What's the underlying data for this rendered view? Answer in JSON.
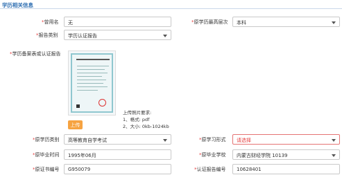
{
  "section": {
    "title": "学历相关信息"
  },
  "form": {
    "used_name": {
      "label": "曾用名",
      "value": "无"
    },
    "highest_level": {
      "label": "原学历最高层次",
      "value": "本科"
    },
    "report_type": {
      "label": "报告类别",
      "value": "学历认证报告"
    },
    "cert_upload": {
      "label": "学历备案表或认证报告",
      "upload_label": "上传"
    },
    "requirements": {
      "title": "上传照片要求:",
      "format": "1、格式: pdf",
      "size": "2、大小: 0kb-1024kb"
    },
    "edu_type": {
      "label": "原学历类别",
      "value": "高等教育自学考试"
    },
    "study_form": {
      "label": "原学习形式",
      "placeholder": "请选择"
    },
    "grad_time": {
      "label": "原毕业时间",
      "value": "1995年06月"
    },
    "grad_school": {
      "label": "原毕业学校",
      "value": "内蒙古财经学院 10139"
    },
    "cert_no": {
      "label": "原证书编号",
      "value": "G950079"
    },
    "report_no": {
      "label": "认证报告编号",
      "value": "10628401"
    }
  },
  "colors": {
    "accent": "#2b6cb0",
    "required": "#e53e3e",
    "upload": "#f6a341"
  }
}
